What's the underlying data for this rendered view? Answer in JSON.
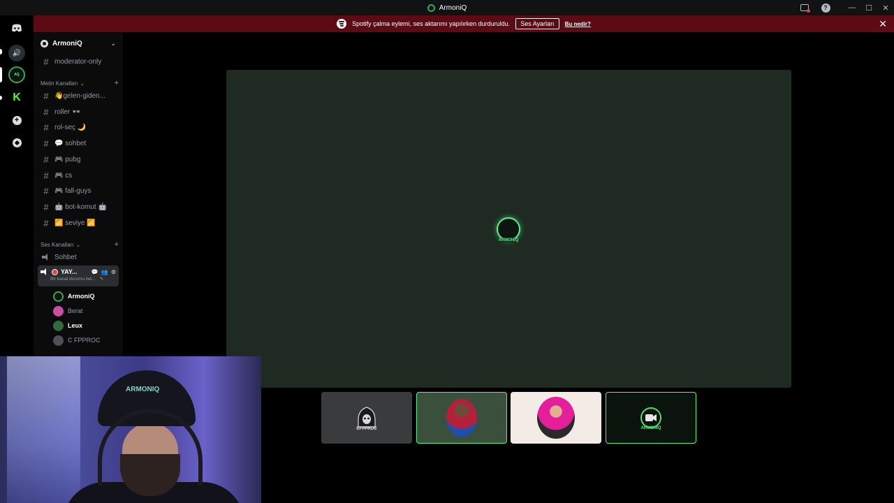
{
  "window": {
    "title": "ArmoniQ"
  },
  "banner": {
    "message": "Spotify çalma eylemi, ses aktarımı yapılırken durduruldu.",
    "button_label": "Ses Ayarları",
    "link_label": "Bu nedir?",
    "close_glyph": "✕"
  },
  "server": {
    "name": "ArmoniQ",
    "chevron": "⌄"
  },
  "channels": {
    "pinned": {
      "name": "moderator-only"
    },
    "text_category": "Metin Kanalları",
    "text_channels": [
      {
        "name": "👋gelen-giden..."
      },
      {
        "name": "roller 👓"
      },
      {
        "name": "rol-seç 🌙"
      },
      {
        "name": "💬 sohbet"
      },
      {
        "name": "🎮 pubg"
      },
      {
        "name": "🎮 cs"
      },
      {
        "name": "🎮 fall-guys"
      },
      {
        "name": "🤖 bot-komut 🤖"
      },
      {
        "name": "📶 seviye 📶"
      }
    ],
    "voice_category": "Ses Kanalları",
    "voice_channels": [
      {
        "name": "Sohbet"
      }
    ],
    "active_voice": {
      "name": "YAY...",
      "status": "Bir kanal durumu bel..."
    },
    "voice_users": [
      {
        "name": "ArmoniQ",
        "color": "#3ba55d"
      },
      {
        "name": "Berat",
        "color": "#c94fa0"
      },
      {
        "name": "Leux",
        "color": "#3ba55d"
      },
      {
        "name": "Ͼ FPPROϾ",
        "color": "#4e5058"
      }
    ]
  },
  "stage": {
    "main_avatar_label": "ARMONIQ",
    "thumbnails": [
      {
        "label": "ϾFPPROϾ"
      },
      {
        "label": ""
      },
      {
        "label": ""
      },
      {
        "label": "ARMONIQ"
      }
    ]
  },
  "webcam": {
    "cap_text": "ARMONIQ"
  },
  "colors": {
    "accent_green": "#3ba55d",
    "banner_red": "#5c0b14",
    "stage_bg": "#1f2a23"
  }
}
